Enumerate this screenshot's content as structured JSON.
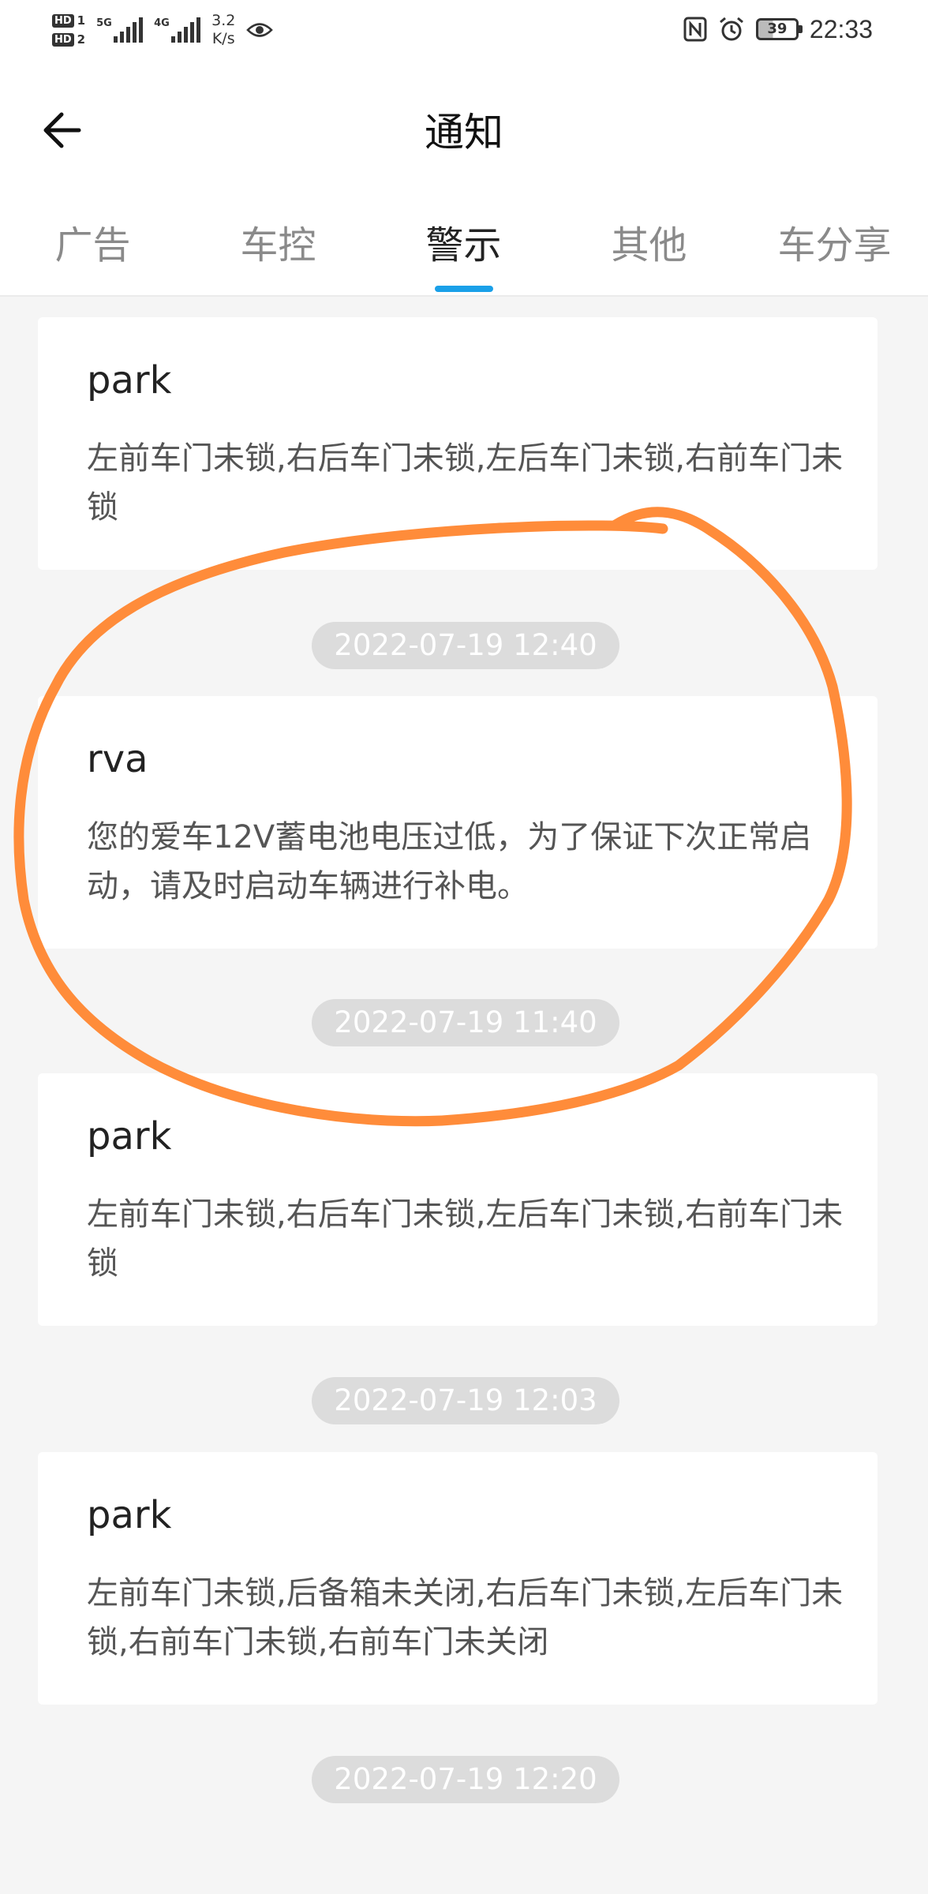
{
  "status_bar": {
    "hd1": "HD",
    "hd1_num": "1",
    "hd2": "HD",
    "hd2_num": "2",
    "net1": "5G",
    "net2": "4G",
    "speed_value": "3.2",
    "speed_unit": "K/s",
    "battery": "39",
    "time": "22:33"
  },
  "header": {
    "title": "通知",
    "back_icon": "arrow-left-icon"
  },
  "tabs": [
    {
      "label": "广告",
      "active": false
    },
    {
      "label": "车控",
      "active": false
    },
    {
      "label": "警示",
      "active": true
    },
    {
      "label": "其他",
      "active": false
    },
    {
      "label": "车分享",
      "active": false
    }
  ],
  "messages": [
    {
      "title": "park",
      "body": "左前车门未锁,右后车门未锁,左后车门未锁,右前车门未锁"
    },
    {
      "timestamp": "2022-07-19 12:40",
      "title": "rva",
      "body": "您的爱车12V蓄电池电压过低，为了保证下次正常启动，请及时启动车辆进行补电。"
    },
    {
      "timestamp": "2022-07-19 11:40",
      "title": "park",
      "body": "左前车门未锁,右后车门未锁,左后车门未锁,右前车门未锁"
    },
    {
      "timestamp": "2022-07-19 12:03",
      "title": "park",
      "body": "左前车门未锁,后备箱未关闭,右后车门未锁,左后车门未锁,右前车门未锁,右前车门未关闭"
    },
    {
      "timestamp": "2022-07-19 12:20"
    }
  ],
  "colors": {
    "accent": "#1aa0e8",
    "annotation": "#ff8c3a",
    "background": "#f5f5f5"
  }
}
